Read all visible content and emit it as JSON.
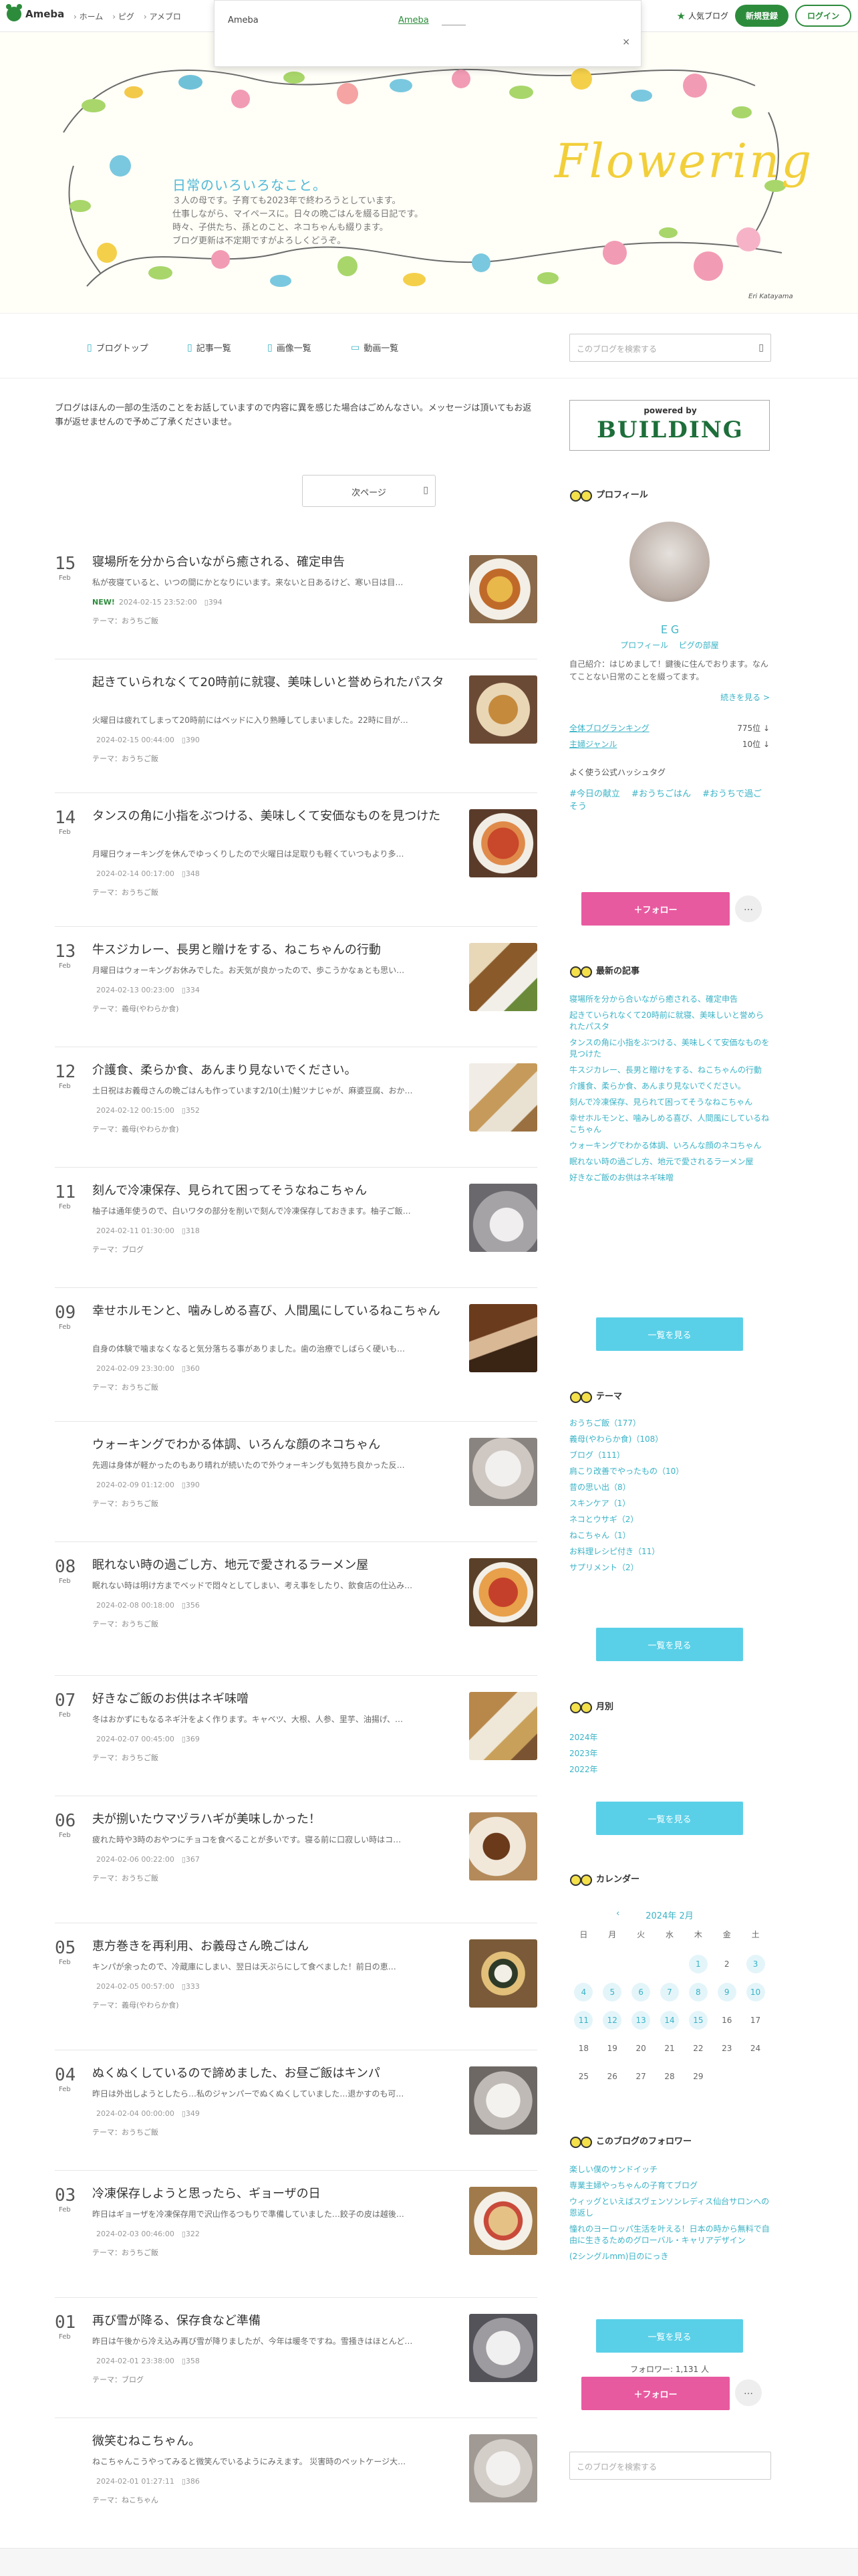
{
  "topbar": {
    "logo": "Ameba",
    "nav": [
      "ホーム",
      "ピグ",
      "アメブロ"
    ],
    "overlay_title": "Ameba",
    "overlay_link": "Ameba",
    "popular_blog": "人気ブログ",
    "register": "新規登録",
    "login": "ログイン",
    "close": "×"
  },
  "header": {
    "title": "日常のいろいろなこと。",
    "desc": [
      "３人の母です。子育ても2023年で終わろうとしています。",
      "仕事しながら、マイペースに。日々の晩ごはんを綴る日記です。",
      "時々、子供たち、孫とのこと、ネコちゃんも綴ります。",
      "ブログ更新は不定期ですがよろしくどうぞ。"
    ],
    "decor_text": "Flowering",
    "signature": "Eri Katayama"
  },
  "nav": {
    "items": [
      "ブログトップ",
      "記事一覧",
      "画像一覧",
      "動画一覧"
    ],
    "search_placeholder": "このブログを検索する"
  },
  "main": {
    "notice": "ブログはほんの一部の生活のことをお話していますので内容に異を感じた場合はごめんなさい。メッセージは頂いてもお返事が返せませんので予めご了承くださいませ。",
    "next_page": "次ページ"
  },
  "entries": [
    {
      "day": "15",
      "month": "Feb",
      "title": "寝場所を分から合いながら癒される、確定申告",
      "excerpt": "私が夜寝ていると、いつの間にかとなりにいます。来ないと日あるけど、寒い日は目…",
      "is_new": true,
      "new_label": "NEW!",
      "date": "2024-02-15 23:52:00",
      "count": "394",
      "theme": "テーマ：おうちご飯",
      "thumb": "food1"
    },
    {
      "day": "",
      "month": "",
      "title": "起きていられなくて20時前に就寝、美味しいと誉められたパスタ",
      "excerpt": "火曜日は疲れてしまって20時前にはベッドに入り熟睡してしまいました。22時に目が…",
      "is_new": false,
      "new_label": "",
      "date": "2024-02-15 00:44:00",
      "count": "390",
      "theme": "テーマ：おうちご飯",
      "thumb": "food2"
    },
    {
      "day": "14",
      "month": "Feb",
      "title": "タンスの角に小指をぶつける、美味しくて安価なものを見つけた",
      "excerpt": "月曜日ウォーキングを休んでゆっくりしたので火曜日は足取りも軽くていつもより多…",
      "is_new": false,
      "new_label": "",
      "date": "2024-02-14 00:17:00",
      "count": "348",
      "theme": "テーマ：おうちご飯",
      "thumb": "food3"
    },
    {
      "day": "13",
      "month": "Feb",
      "title": "牛スジカレー、長男と贈けをする、ねこちゃんの行動",
      "excerpt": "月曜日はウォーキングお休みでした。お天気が良かったので、歩こうかなぁとも思い…",
      "is_new": false,
      "new_label": "",
      "date": "2024-02-13 00:23:00",
      "count": "334",
      "theme": "テーマ：義母(やわらか食)",
      "thumb": "food4"
    },
    {
      "day": "12",
      "month": "Feb",
      "title": "介護食、柔らか食、あんまり見ないでください。",
      "excerpt": "土日祝はお義母さんの晩ごはんも作っています2/10(土)鮭ツナじゃが、麻婆豆腐、おか…",
      "is_new": false,
      "new_label": "",
      "date": "2024-02-12 00:15:00",
      "count": "352",
      "theme": "テーマ：義母(やわらか食)",
      "thumb": "food5"
    },
    {
      "day": "11",
      "month": "Feb",
      "title": "刻んで冷凍保存、見られて困ってそうなねこちゃん",
      "excerpt": "柚子は通年使うので、白いワタの部分を削いで刻んで冷凍保存しておきます。柚子ご飯…",
      "is_new": false,
      "new_label": "",
      "date": "2024-02-11 01:30:00",
      "count": "318",
      "theme": "テーマ：ブログ",
      "thumb": "cat1"
    },
    {
      "day": "09",
      "month": "Feb",
      "title": "幸せホルモンと、噛みしめる喜び、人間風にしているねこちゃん",
      "excerpt": "自身の体験で噛まなくなると気分落ちる事がありました。歯の治療でしばらく硬いも…",
      "is_new": false,
      "new_label": "",
      "date": "2024-02-09 23:30:00",
      "count": "360",
      "theme": "テーマ：おうちご飯",
      "thumb": "cat2"
    },
    {
      "day": "",
      "month": "",
      "title": "ウォーキングでわかる体調、いろんな顔のネコちゃん",
      "excerpt": "先週は身体が軽かったのもあり晴れが続いたので外ウォーキングも気持ち良かった反…",
      "is_new": false,
      "new_label": "",
      "date": "2024-02-09 01:12:00",
      "count": "390",
      "theme": "テーマ：おうちご飯",
      "thumb": "cat3"
    },
    {
      "day": "08",
      "month": "Feb",
      "title": "眠れない時の過ごし方、地元で愛されるラーメン屋",
      "excerpt": "眠れない時は明け方までベッドで悶々としてしまい、考え事をしたり、飲食店の仕込み…",
      "is_new": false,
      "new_label": "",
      "date": "2024-02-08 00:18:00",
      "count": "356",
      "theme": "テーマ：おうちご飯",
      "thumb": "food6"
    },
    {
      "day": "07",
      "month": "Feb",
      "title": "好きなご飯のお供はネギ味噌",
      "excerpt": "冬はおかずにもなるネギ汁をよく作ります。キャベツ、大根、人参、里芋、油揚げ、…",
      "is_new": false,
      "new_label": "",
      "date": "2024-02-07 00:45:00",
      "count": "369",
      "theme": "テーマ：おうちご飯",
      "thumb": "food7"
    },
    {
      "day": "06",
      "month": "Feb",
      "title": "夫が捌いたウマヅラハギが美味しかった！",
      "excerpt": "疲れた時や3時のおやつにチョコを食べることが多いです。寝る前に口寂しい時はコ…",
      "is_new": false,
      "new_label": "",
      "date": "2024-02-06 00:22:00",
      "count": "367",
      "theme": "テーマ：おうちご飯",
      "thumb": "food8"
    },
    {
      "day": "05",
      "month": "Feb",
      "title": "恵方巻きを再利用、お義母さん晩ごはん",
      "excerpt": "キンパが余ったので、冷蔵庫にしまい、翌日は天ぷらにして食べました！前日の恵…",
      "is_new": false,
      "new_label": "",
      "date": "2024-02-05 00:57:00",
      "count": "333",
      "theme": "テーマ：義母(やわらか食)",
      "thumb": "food9"
    },
    {
      "day": "04",
      "month": "Feb",
      "title": "ぬくぬくしているので諦めました、お昼ご飯はキンパ",
      "excerpt": "昨日は外出しようとしたら…私のジャンパーでぬくぬくしていました…退かすのも可…",
      "is_new": false,
      "new_label": "",
      "date": "2024-02-04 00:00:00",
      "count": "349",
      "theme": "テーマ：おうちご飯",
      "thumb": "cat4"
    },
    {
      "day": "03",
      "month": "Feb",
      "title": "冷凍保存しようと思ったら、ギョーザの日",
      "excerpt": "昨日はギョーザを冷凍保存用で沢山作るつもりで準備していました…餃子の皮は越後…",
      "is_new": false,
      "new_label": "",
      "date": "2024-02-03 00:46:00",
      "count": "322",
      "theme": "テーマ：おうちご飯",
      "thumb": "food10"
    },
    {
      "day": "01",
      "month": "Feb",
      "title": "再び雪が降る、保存食など準備",
      "excerpt": "昨日は午後から冷え込み再び雪が降りましたが、今年は暖冬ですね。雪掻きはほとんど…",
      "is_new": false,
      "new_label": "",
      "date": "2024-02-01 23:38:00",
      "count": "358",
      "theme": "テーマ：ブログ",
      "thumb": "cat5"
    },
    {
      "day": "",
      "month": "",
      "title": "微笑むねこちゃん。",
      "excerpt": "ねこちゃんこうやってみると微笑んでいるようにみえます。 災害時のペットケージ大…",
      "is_new": false,
      "new_label": "",
      "date": "2024-02-01 01:27:11",
      "count": "386",
      "theme": "テーマ：ねこちゃん",
      "thumb": "cat6"
    }
  ],
  "sidebar": {
    "banner_top": "powered by",
    "banner_main": "BUILDING",
    "profile_head": "プロフィール",
    "name": "ＥＧ",
    "profile_links": [
      "プロフィール",
      "ピグの部屋"
    ],
    "intro": "自己紹介：はじめまして！鍵後に住んでおります。なんてことない日常のことを綴ってます。",
    "more": "続きを見る >",
    "rank1_label": "全体ブログランキング",
    "rank1_value": "775位 ↓",
    "rank2_label": "主婦ジャンル",
    "rank2_value": "10位 ↓",
    "hash_label": "よく使う公式ハッシュタグ",
    "hashtags": [
      "#今日の献立",
      "#おうちごはん",
      "#おうちで過ごそう"
    ],
    "follow": "＋フォロー",
    "dots": "…",
    "latest_head": "最新の記事",
    "latest": [
      "寝場所を分から合いながら癒される、確定申告",
      "起きていられなくて20時前に就寝、美味しいと誉められたパスタ",
      "タンスの角に小指をぶつける、美味しくて安価なものを見つけた",
      "牛スジカレー、長男と贈けをする、ねこちゃんの行動",
      "介護食、柔らか食、あんまり見ないでください。",
      "刻んで冷凍保存、見られて困ってそうなねこちゃん",
      "幸せホルモンと、噛みしめる喜び、人間風にしているねこちゃん",
      "ウォーキングでわかる体調、いろんな顔のネコちゃん",
      "眠れない時の過ごし方、地元で愛されるラーメン屋",
      "好きなご飯のお供はネギ味噌"
    ],
    "list_button": "一覧を見る",
    "theme_head": "テーマ",
    "themes": [
      "おうちご飯（177）",
      "義母(やわらか食)（108）",
      "ブログ（111）",
      "肩こり改善でやったもの（10）",
      "昔の思い出（8）",
      "スキンケア（1）",
      "ネコとウサギ（2）",
      "ねこちゃん（1）",
      "お料理レシピ付き（11）",
      "サプリメント（2）"
    ],
    "month_head": "月別",
    "months": [
      "2024年",
      "2023年",
      "2022年"
    ],
    "calendar_head": "カレンダー",
    "calendar_title": "2024年 2月",
    "calendar_prev": "‹",
    "weekdays": [
      "日",
      "月",
      "火",
      "水",
      "木",
      "金",
      "土"
    ],
    "days": [
      "",
      "",
      "",
      "",
      "1",
      "2",
      "3",
      "4",
      "5",
      "6",
      "7",
      "8",
      "9",
      "10",
      "11",
      "12",
      "13",
      "14",
      "15",
      "16",
      "17",
      "18",
      "19",
      "20",
      "21",
      "22",
      "23",
      "24",
      "25",
      "26",
      "27",
      "28",
      "29",
      "",
      ""
    ],
    "posted_days": [
      "1",
      "3",
      "4",
      "5",
      "6",
      "7",
      "8",
      "9",
      "10",
      "11",
      "12",
      "13",
      "14",
      "15"
    ],
    "followers_head": "このブログのフォロワー",
    "follower_blogs": [
      "楽しい僕のサンドイッチ",
      "専業主婦やっちゃんの子育てブログ",
      "ウィッグといえばスヴェンソンレディス仙台サロンへの恩返し",
      "憧れのヨーロッパ生活を叶える！日本の時から無料で自由に生きるためのグローバル・キャリアデザイン",
      "(2シングルmm)日のにっき"
    ],
    "follower_count": "フォロワー: 1,131 人",
    "search_placeholder": "このブログを検索する"
  },
  "colors": {
    "accent_green": "#2d8c3c",
    "link_blue": "#39b3c6",
    "pink": "#e85aa0",
    "light_blue": "#5ad0e8"
  }
}
